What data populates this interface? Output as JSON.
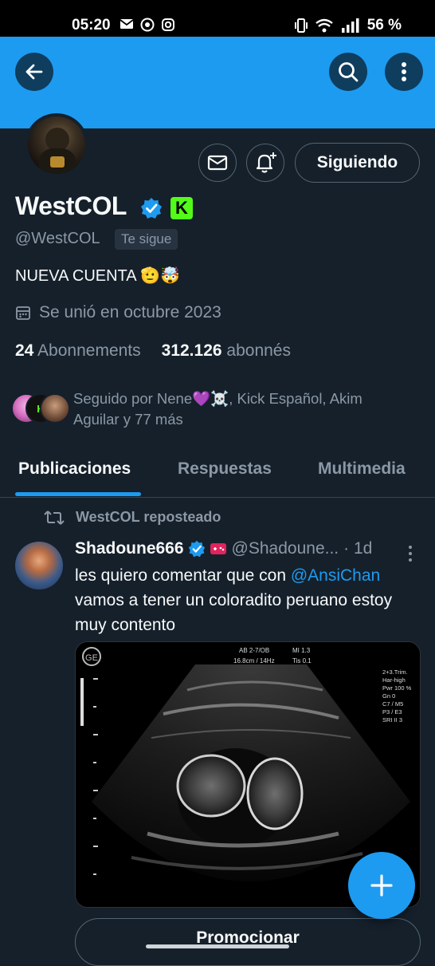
{
  "status_bar": {
    "time": "05:20",
    "battery": "56 %",
    "icons": [
      "mail-icon",
      "whatsapp-icon",
      "instagram-icon",
      "vibrate-icon",
      "wifi-icon",
      "signal-icon"
    ]
  },
  "profile": {
    "name": "WestCOL",
    "handle": "@WestCOL",
    "follows_you": "Te sigue",
    "bio": "NUEVA CUENTA 🫡🤯",
    "joined": "Se unió en octubre 2023",
    "following_count": "24",
    "following_label": "Abonnements",
    "followers_count": "312.126",
    "followers_label": "abonnés",
    "followed_by": "Seguido por Nene💜☠️, Kick Español, Akim Aguilar y 77 más",
    "following_button": "Siguiendo",
    "kick_letter": "K"
  },
  "tabs": {
    "posts": "Publicaciones",
    "replies": "Respuestas",
    "media": "Multimedia"
  },
  "tweet": {
    "repost_label": "WestCOL reposteado",
    "author_name": "Shadoune666",
    "author_handle": "@Shadoune...",
    "time": "· 1d",
    "text_before": "les quiero comentar que con ",
    "mention": "@AnsiChan",
    "text_after": " vamos a tener un coloradito peruano estoy muy contento",
    "promo_button": "Promocionar"
  },
  "ultrasound": {
    "header_left": "AB 2-7/OB",
    "header_depth": "16.8cm / 14Hz",
    "header_mi": "MI 1.3",
    "header_tis": "Tis 0.1",
    "side_info": [
      "2+3.Trim.",
      "Har-high",
      "Pwr 100 %",
      "Gn 0",
      "C7 / M5",
      "P3 / E3",
      "SRI II 3"
    ]
  },
  "colors": {
    "accent": "#1d9bf0",
    "background": "#15202b",
    "kick_green": "#53fc18"
  }
}
